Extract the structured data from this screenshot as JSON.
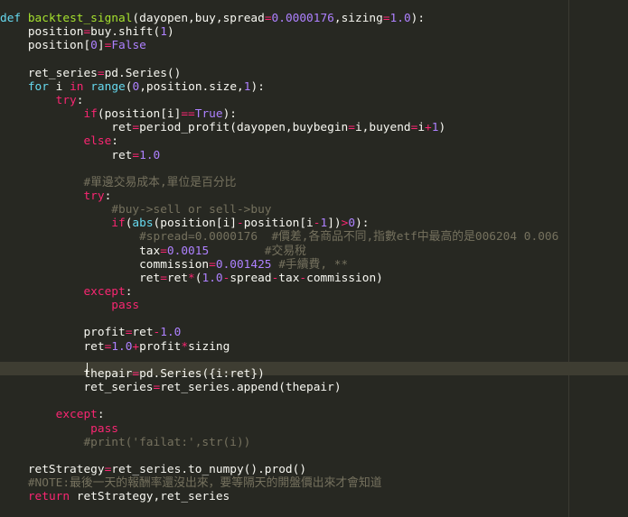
{
  "editor": {
    "theme_colors": {
      "background": "#272822",
      "keyword": "#66d9ef",
      "function": "#a6e22e",
      "number": "#ae81ff",
      "operator": "#f92672",
      "string": "#e6db74",
      "comment": "#75715e",
      "text": "#f8f8f2"
    },
    "current_line": 27,
    "lines": [
      [
        [
          "kw",
          "def"
        ],
        [
          "pl",
          " "
        ],
        [
          "fn",
          "backtest_signal"
        ],
        [
          "pl",
          "(dayopen,buy,spread"
        ],
        [
          "op",
          "="
        ],
        [
          "num",
          "0.0000176"
        ],
        [
          "pl",
          ",sizing"
        ],
        [
          "op",
          "="
        ],
        [
          "num",
          "1.0"
        ],
        [
          "pl",
          "):"
        ]
      ],
      [
        [
          "pl",
          "    position"
        ],
        [
          "op",
          "="
        ],
        [
          "pl",
          "buy.shift("
        ],
        [
          "num",
          "1"
        ],
        [
          "pl",
          ")"
        ]
      ],
      [
        [
          "pl",
          "    position["
        ],
        [
          "num",
          "0"
        ],
        [
          "pl",
          "]"
        ],
        [
          "op",
          "="
        ],
        [
          "bool",
          "False"
        ]
      ],
      [],
      [
        [
          "pl",
          "    ret_series"
        ],
        [
          "op",
          "="
        ],
        [
          "pl",
          "pd.Series()"
        ]
      ],
      [
        [
          "pl",
          "    "
        ],
        [
          "kw",
          "for"
        ],
        [
          "pl",
          " i "
        ],
        [
          "op",
          "in"
        ],
        [
          "pl",
          " "
        ],
        [
          "bi",
          "range"
        ],
        [
          "pl",
          "("
        ],
        [
          "num",
          "0"
        ],
        [
          "pl",
          ",position.size,"
        ],
        [
          "num",
          "1"
        ],
        [
          "pl",
          "):"
        ]
      ],
      [
        [
          "pl",
          "        "
        ],
        [
          "op",
          "try"
        ],
        [
          "pl",
          ":"
        ]
      ],
      [
        [
          "pl",
          "            "
        ],
        [
          "op",
          "if"
        ],
        [
          "pl",
          "(position[i]"
        ],
        [
          "op",
          "=="
        ],
        [
          "bool",
          "True"
        ],
        [
          "pl",
          "):"
        ]
      ],
      [
        [
          "pl",
          "                ret"
        ],
        [
          "op",
          "="
        ],
        [
          "pl",
          "period_profit(dayopen,buybegin"
        ],
        [
          "op",
          "="
        ],
        [
          "pl",
          "i,buyend"
        ],
        [
          "op",
          "="
        ],
        [
          "pl",
          "i"
        ],
        [
          "op",
          "+"
        ],
        [
          "num",
          "1"
        ],
        [
          "pl",
          ")"
        ]
      ],
      [
        [
          "pl",
          "            "
        ],
        [
          "op",
          "else"
        ],
        [
          "pl",
          ":"
        ]
      ],
      [
        [
          "pl",
          "                ret"
        ],
        [
          "op",
          "="
        ],
        [
          "num",
          "1.0"
        ]
      ],
      [],
      [
        [
          "pl",
          "            "
        ],
        [
          "com",
          "#單邊交易成本,單位是百分比"
        ]
      ],
      [
        [
          "pl",
          "            "
        ],
        [
          "op",
          "try"
        ],
        [
          "pl",
          ":"
        ]
      ],
      [
        [
          "pl",
          "                "
        ],
        [
          "com",
          "#buy->sell or sell->buy"
        ]
      ],
      [
        [
          "pl",
          "                "
        ],
        [
          "op",
          "if"
        ],
        [
          "pl",
          "("
        ],
        [
          "bi",
          "abs"
        ],
        [
          "pl",
          "(position[i]"
        ],
        [
          "op",
          "-"
        ],
        [
          "pl",
          "position[i"
        ],
        [
          "op",
          "-"
        ],
        [
          "num",
          "1"
        ],
        [
          "pl",
          "])"
        ],
        [
          "op",
          ">"
        ],
        [
          "num",
          "0"
        ],
        [
          "pl",
          "):"
        ]
      ],
      [
        [
          "pl",
          "                    "
        ],
        [
          "com",
          "#spread=0.0000176  #價差,各商品不同,指數etf中最高的是006204 0.006"
        ]
      ],
      [
        [
          "pl",
          "                    tax"
        ],
        [
          "op",
          "="
        ],
        [
          "num",
          "0.0015"
        ],
        [
          "pl",
          "        "
        ],
        [
          "com",
          "#交易稅"
        ]
      ],
      [
        [
          "pl",
          "                    commission"
        ],
        [
          "op",
          "="
        ],
        [
          "num",
          "0.001425"
        ],
        [
          "pl",
          " "
        ],
        [
          "com",
          "#手續費, **"
        ]
      ],
      [
        [
          "pl",
          "                    ret"
        ],
        [
          "op",
          "="
        ],
        [
          "pl",
          "ret"
        ],
        [
          "op",
          "*"
        ],
        [
          "pl",
          "("
        ],
        [
          "num",
          "1.0"
        ],
        [
          "op",
          "-"
        ],
        [
          "pl",
          "spread"
        ],
        [
          "op",
          "-"
        ],
        [
          "pl",
          "tax"
        ],
        [
          "op",
          "-"
        ],
        [
          "pl",
          "commission)"
        ]
      ],
      [
        [
          "pl",
          "            "
        ],
        [
          "op",
          "except"
        ],
        [
          "pl",
          ":"
        ]
      ],
      [
        [
          "pl",
          "                "
        ],
        [
          "op",
          "pass"
        ]
      ],
      [],
      [
        [
          "pl",
          "            profit"
        ],
        [
          "op",
          "="
        ],
        [
          "pl",
          "ret"
        ],
        [
          "op",
          "-"
        ],
        [
          "num",
          "1.0"
        ]
      ],
      [
        [
          "pl",
          "            ret"
        ],
        [
          "op",
          "="
        ],
        [
          "num",
          "1.0"
        ],
        [
          "op",
          "+"
        ],
        [
          "pl",
          "profit"
        ],
        [
          "op",
          "*"
        ],
        [
          "pl",
          "sizing"
        ]
      ],
      [],
      [
        [
          "pl",
          "            thepair"
        ],
        [
          "op",
          "="
        ],
        [
          "pl",
          "pd.Series({i:ret})"
        ]
      ],
      [
        [
          "pl",
          "            ret_series"
        ],
        [
          "op",
          "="
        ],
        [
          "pl",
          "ret_series.append(thepair)"
        ]
      ],
      [],
      [
        [
          "pl",
          "        "
        ],
        [
          "op",
          "except"
        ],
        [
          "pl",
          ":"
        ]
      ],
      [
        [
          "pl",
          "             "
        ],
        [
          "op",
          "pass"
        ]
      ],
      [
        [
          "pl",
          "            "
        ],
        [
          "com",
          "#print('failat:',str(i))"
        ]
      ],
      [],
      [
        [
          "pl",
          "    retStrategy"
        ],
        [
          "op",
          "="
        ],
        [
          "pl",
          "ret_series.to_numpy().prod()"
        ]
      ],
      [
        [
          "pl",
          "    "
        ],
        [
          "com",
          "#NOTE:最後一天的報酬率還沒出來，要等隔天的開盤價出來才會知道"
        ]
      ],
      [
        [
          "pl",
          "    "
        ],
        [
          "op",
          "return"
        ],
        [
          "pl",
          " retStrategy,ret_series"
        ]
      ]
    ]
  }
}
